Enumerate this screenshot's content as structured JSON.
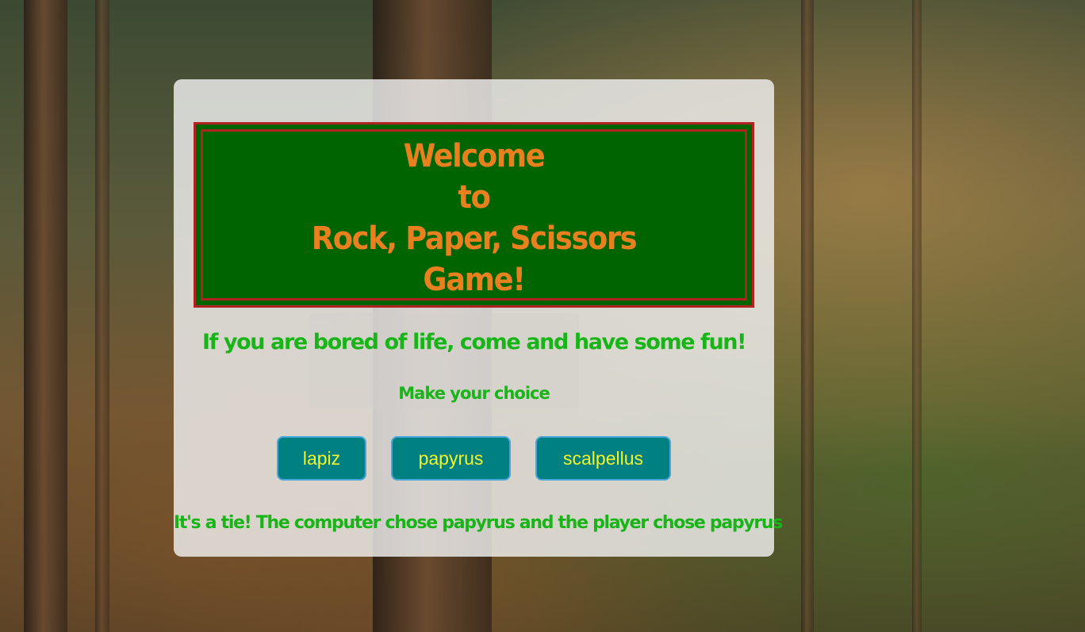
{
  "banner": {
    "line1": "Welcome",
    "line2": "to",
    "line3": "Rock, Paper, Scissors",
    "line4": "Game!"
  },
  "tagline": "If you are bored of life, come and have some fun!",
  "prompt": "Make your choice",
  "buttons": {
    "lapiz": "lapiz",
    "papyrus": "papyrus",
    "scalpellus": "scalpellus"
  },
  "result": "It's a tie! The computer chose papyrus and the player chose papyrus",
  "colors": {
    "banner_bg": "#006400",
    "banner_border": "#b22222",
    "title": "#e9801f",
    "green_text": "#18b418",
    "button_bg": "#008080",
    "button_text": "#f6f32a"
  }
}
